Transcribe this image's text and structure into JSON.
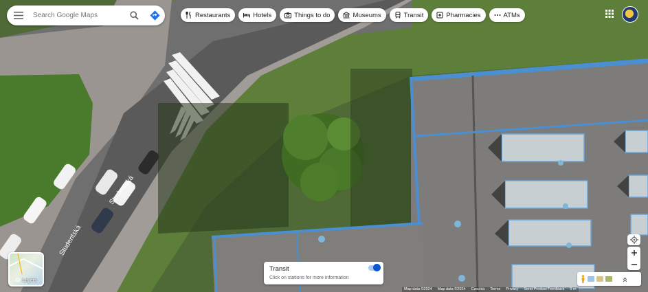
{
  "search": {
    "placeholder": "Search Google Maps"
  },
  "chips": [
    {
      "label": "Restaurants",
      "icon": "fork-knife-icon"
    },
    {
      "label": "Hotels",
      "icon": "bed-icon"
    },
    {
      "label": "Things to do",
      "icon": "camera-icon"
    },
    {
      "label": "Museums",
      "icon": "museum-icon"
    },
    {
      "label": "Transit",
      "icon": "train-icon"
    },
    {
      "label": "Pharmacies",
      "icon": "pharmacy-icon"
    },
    {
      "label": "ATMs",
      "icon": "atm-icon"
    }
  ],
  "map": {
    "street_labels": [
      "Studentská",
      "Studentská"
    ]
  },
  "layers": {
    "label": "Layers"
  },
  "transit": {
    "title": "Transit",
    "subtitle": "Click on stations for more information",
    "enabled": true
  },
  "attribution": [
    "Map data ©2024",
    "Map data ©2024",
    "Czechia",
    "Terms",
    "Privacy",
    "Send Product Feedback",
    "5 m"
  ],
  "colors": {
    "accent": "#1a73e8",
    "toggle": "#0b57d0"
  }
}
